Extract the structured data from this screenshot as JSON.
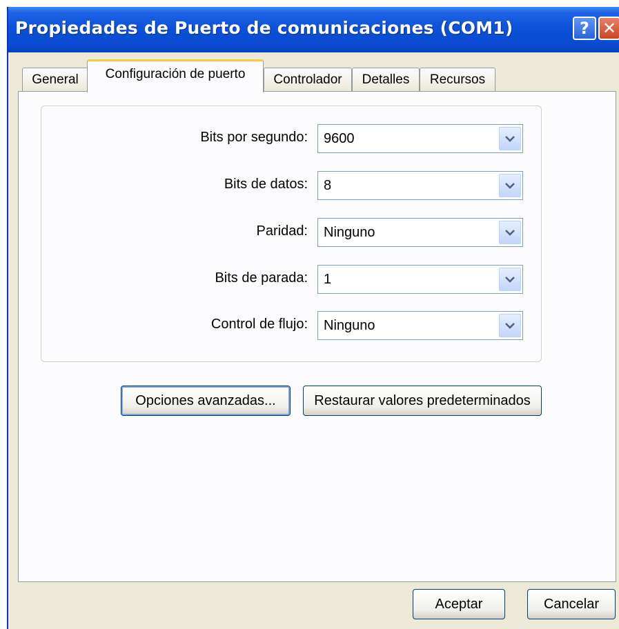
{
  "window": {
    "title": "Propiedades de Puerto de comunicaciones (COM1)",
    "help_label": "?",
    "close_label": "✕"
  },
  "tabs": [
    {
      "label": "General"
    },
    {
      "label": "Configuración de puerto",
      "active": true
    },
    {
      "label": "Controlador"
    },
    {
      "label": "Detalles"
    },
    {
      "label": "Recursos"
    }
  ],
  "settings": [
    {
      "label": "Bits por segundo:",
      "value": "9600"
    },
    {
      "label": "Bits de datos:",
      "value": "8"
    },
    {
      "label": "Paridad:",
      "value": "Ninguno"
    },
    {
      "label": "Bits de parada:",
      "value": "1"
    },
    {
      "label": "Control de flujo:",
      "value": "Ninguno"
    }
  ],
  "buttons": {
    "advanced": "Opciones avanzadas...",
    "restore": "Restaurar valores predeterminados",
    "ok": "Aceptar",
    "cancel": "Cancelar"
  },
  "colors": {
    "titlebar": "#0a50d8",
    "tab_highlight": "#ffc73c",
    "dialog_bg": "#ece9d8",
    "close_red": "#c84622"
  },
  "icons": [
    "help-icon",
    "close-icon",
    "chevron-down-icon"
  ]
}
